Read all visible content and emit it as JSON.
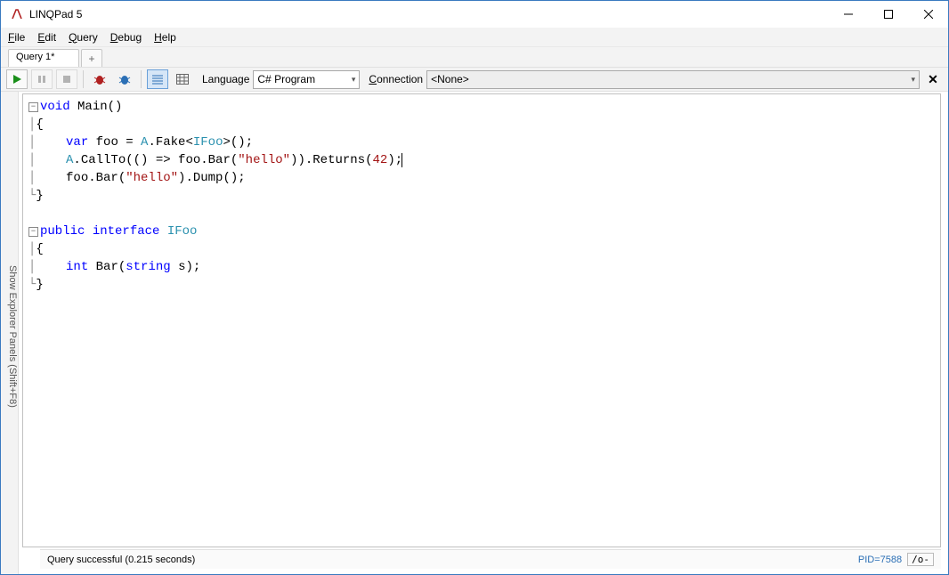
{
  "window": {
    "title": "LINQPad 5"
  },
  "menu": {
    "file": "File",
    "edit": "Edit",
    "query": "Query",
    "debug": "Debug",
    "help": "Help"
  },
  "tabs": {
    "active": "Query 1*",
    "add": "+"
  },
  "toolbar": {
    "language_label": "Language",
    "language_value": "C# Program",
    "connection_label": "Connection",
    "connection_value": "<None>"
  },
  "sidepanel": {
    "label": "Show Explorer Panels  (Shift+F8)"
  },
  "code": {
    "l1_void": "void",
    "l1_main": " Main()",
    "l2": "{",
    "l3_var": "var",
    "l3a": " foo = ",
    "l3_A": "A",
    "l3b": ".Fake<",
    "l3_IFoo": "IFoo",
    "l3c": ">();",
    "l4_A": "A",
    "l4a": ".CallTo(() => foo.Bar(",
    "l4_str": "\"hello\"",
    "l4b": ")).Returns(",
    "l4_num": "42",
    "l4c": ");",
    "l5a": "foo.Bar(",
    "l5_str": "\"hello\"",
    "l5b": ").Dump();",
    "l6": "}",
    "l7_pub": "public",
    "l7_int": "interface",
    "l7_IFoo": " IFoo",
    "l8": "{",
    "l9_int": "int",
    "l9a": " Bar(",
    "l9_str_t": "string",
    "l9b": " s);",
    "l10": "}"
  },
  "status": {
    "msg": "Query successful  (0.215 seconds)",
    "pid": "PID=7588",
    "zoom": "/o-"
  }
}
